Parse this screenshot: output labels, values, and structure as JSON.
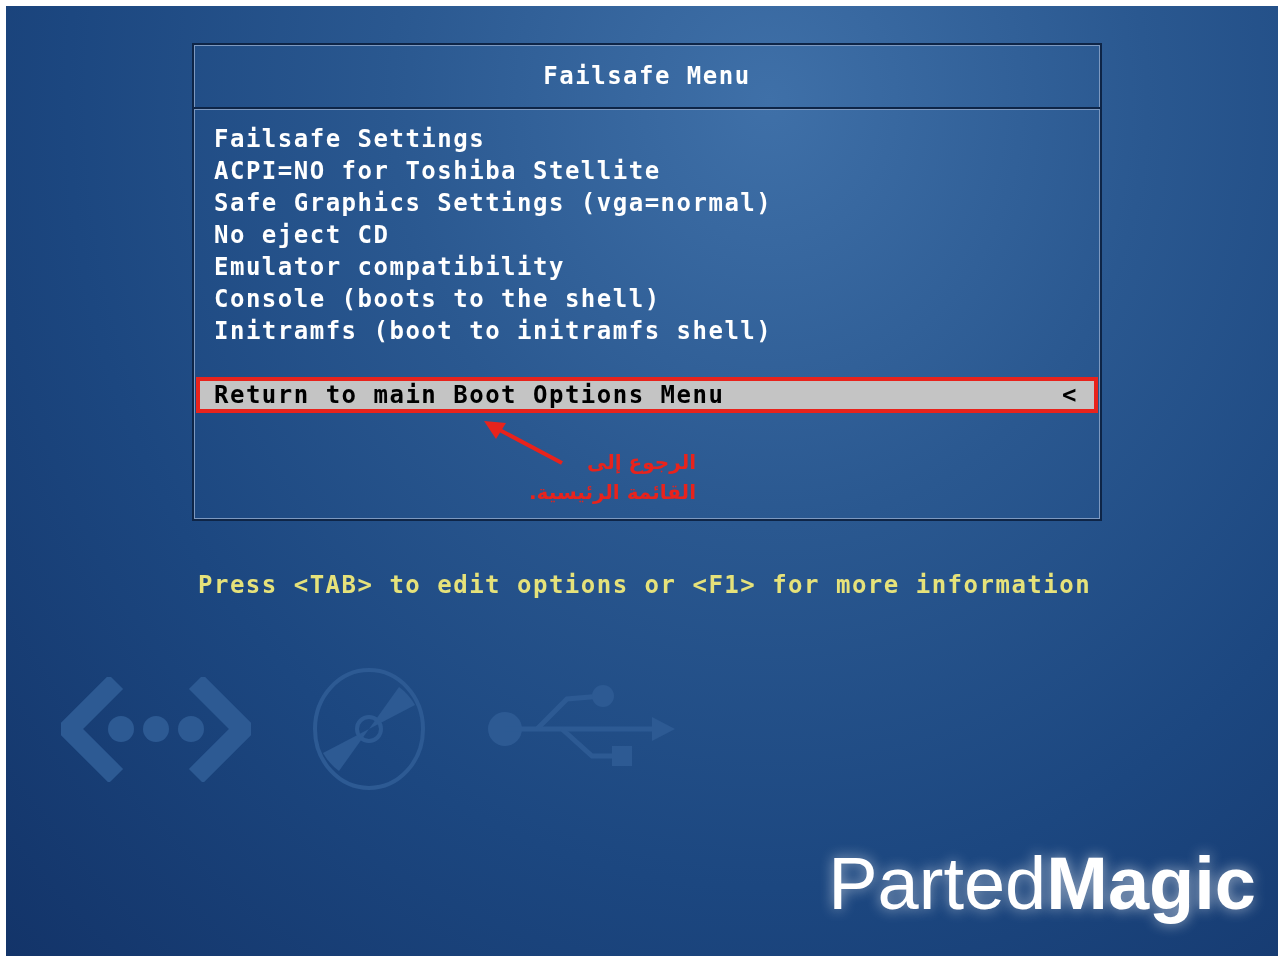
{
  "menu": {
    "title": "Failsafe Menu",
    "entries": [
      {
        "label": "Failsafe Settings",
        "kind": "option",
        "selected": false
      },
      {
        "label": "ACPI=NO for Toshiba Stellite",
        "kind": "option",
        "selected": false
      },
      {
        "label": "Safe Graphics Settings (vga=normal)",
        "kind": "option",
        "selected": false
      },
      {
        "label": "No eject CD",
        "kind": "option",
        "selected": false
      },
      {
        "label": "Emulator compatibility",
        "kind": "option",
        "selected": false
      },
      {
        "label": "Console (boots to the shell)",
        "kind": "option",
        "selected": false
      },
      {
        "label": "Initramfs (boot to initramfs shell)",
        "kind": "option",
        "selected": false
      },
      {
        "label": "Return to main Boot Options Menu",
        "kind": "back",
        "marker": "<",
        "selected": true
      }
    ],
    "annotation": {
      "text": "الرجوع إلى القائمة الرئيسية."
    }
  },
  "hint": "Press <TAB> to edit options or <F1> for more information",
  "logo": {
    "part_1": "Parted",
    "part_2": "Magic"
  }
}
